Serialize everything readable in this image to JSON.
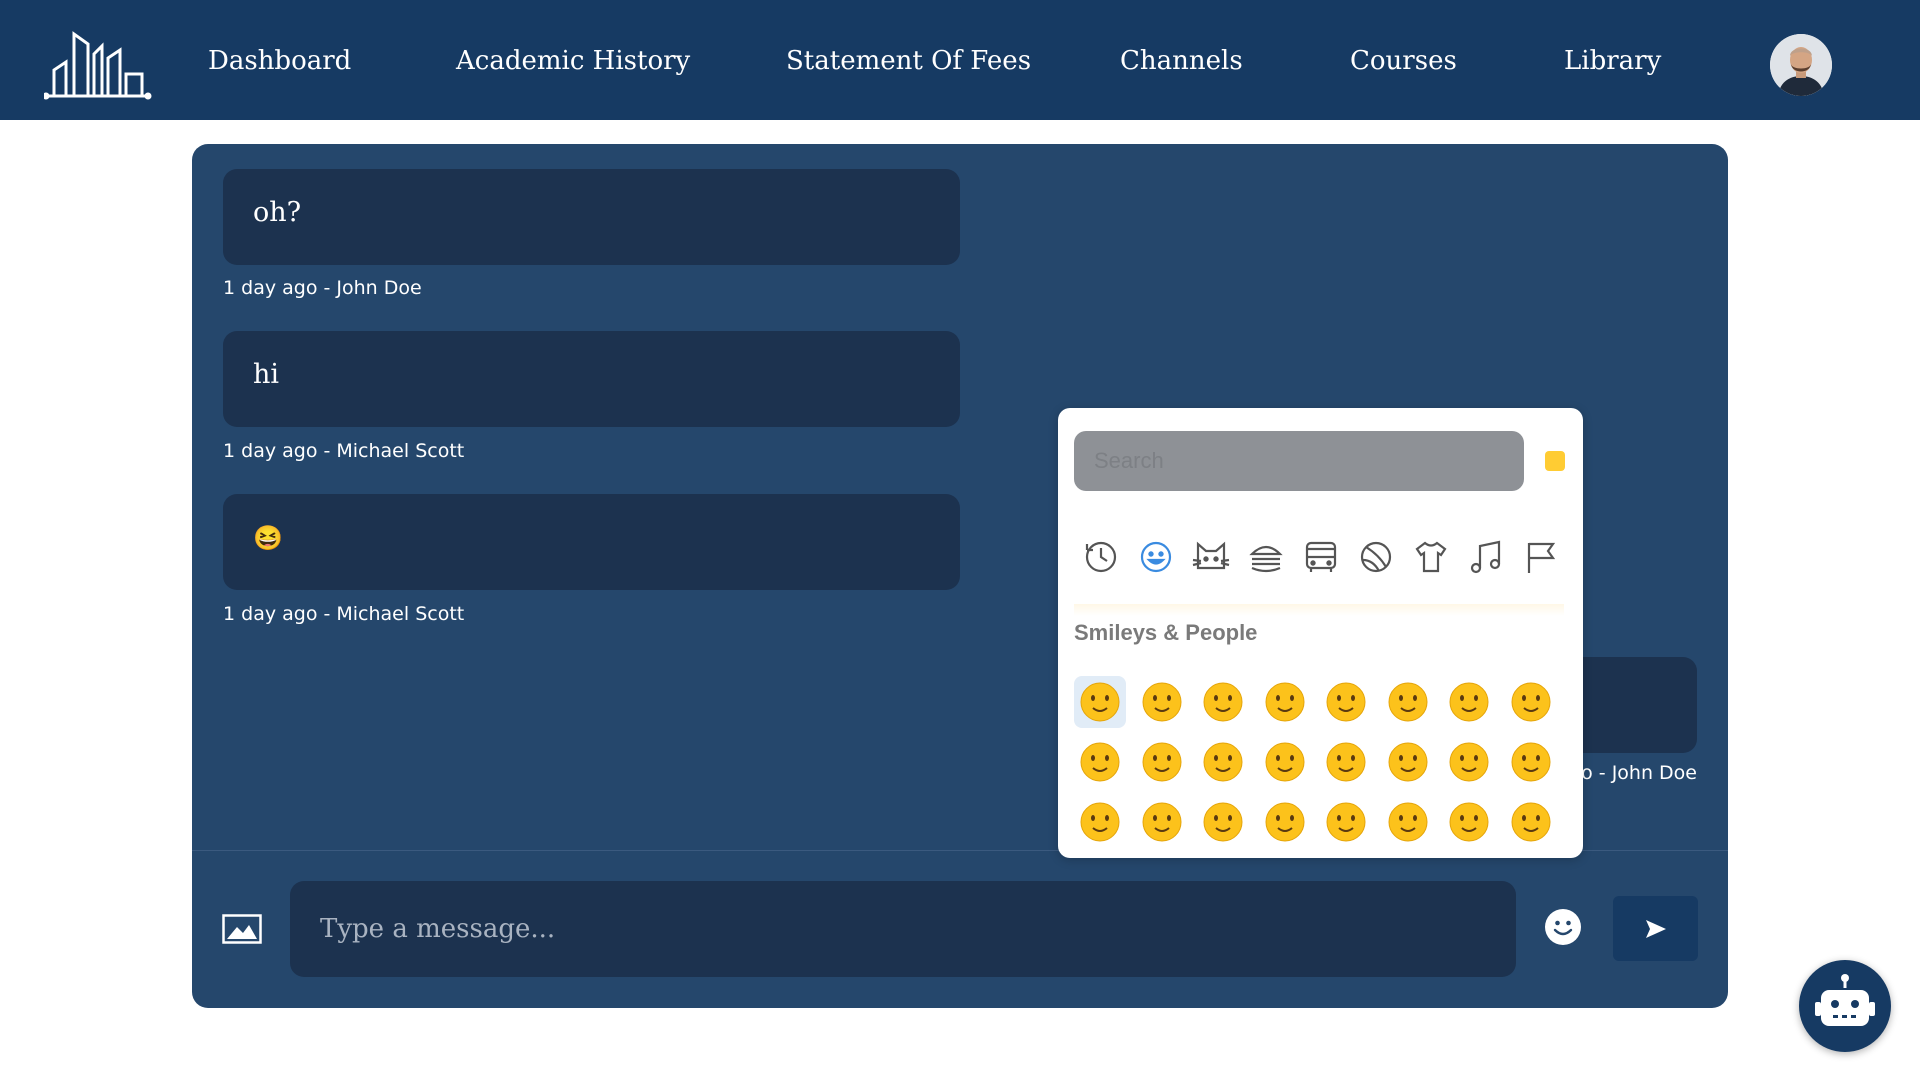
{
  "nav": {
    "items": [
      {
        "label": "Dashboard"
      },
      {
        "label": "Academic History"
      },
      {
        "label": "Statement Of Fees"
      },
      {
        "label": "Channels"
      },
      {
        "label": "Courses"
      },
      {
        "label": "Library"
      }
    ],
    "logo_icon": "city-skyline-icon",
    "avatar_icon": "user-avatar"
  },
  "messages": [
    {
      "text": "oh?",
      "meta": "1 day ago - John Doe"
    },
    {
      "text": "hi",
      "meta": "1 day ago - Michael Scott"
    },
    {
      "text": "😆",
      "meta": "1 day ago - Michael Scott"
    }
  ],
  "right_message": {
    "meta": "o - John Doe"
  },
  "composer": {
    "placeholder": "Type a message...",
    "image_icon": "image-icon",
    "emoji_icon": "smiley-icon",
    "send_icon": "send-icon"
  },
  "emoji_picker": {
    "search_placeholder": "Search",
    "skin_tone_color": "#ffcc33",
    "categories": [
      "recent",
      "smileys",
      "animals",
      "food",
      "travel",
      "activities",
      "objects",
      "symbols",
      "flags"
    ],
    "active_category": "smileys",
    "section_title": "Smileys & People",
    "selected": "star-struck"
  },
  "colors": {
    "navbar": "#163a63",
    "panel": "#25476c",
    "bubble": "#1c324f",
    "accent": "#163a63"
  },
  "robot_icon": "robot-icon"
}
